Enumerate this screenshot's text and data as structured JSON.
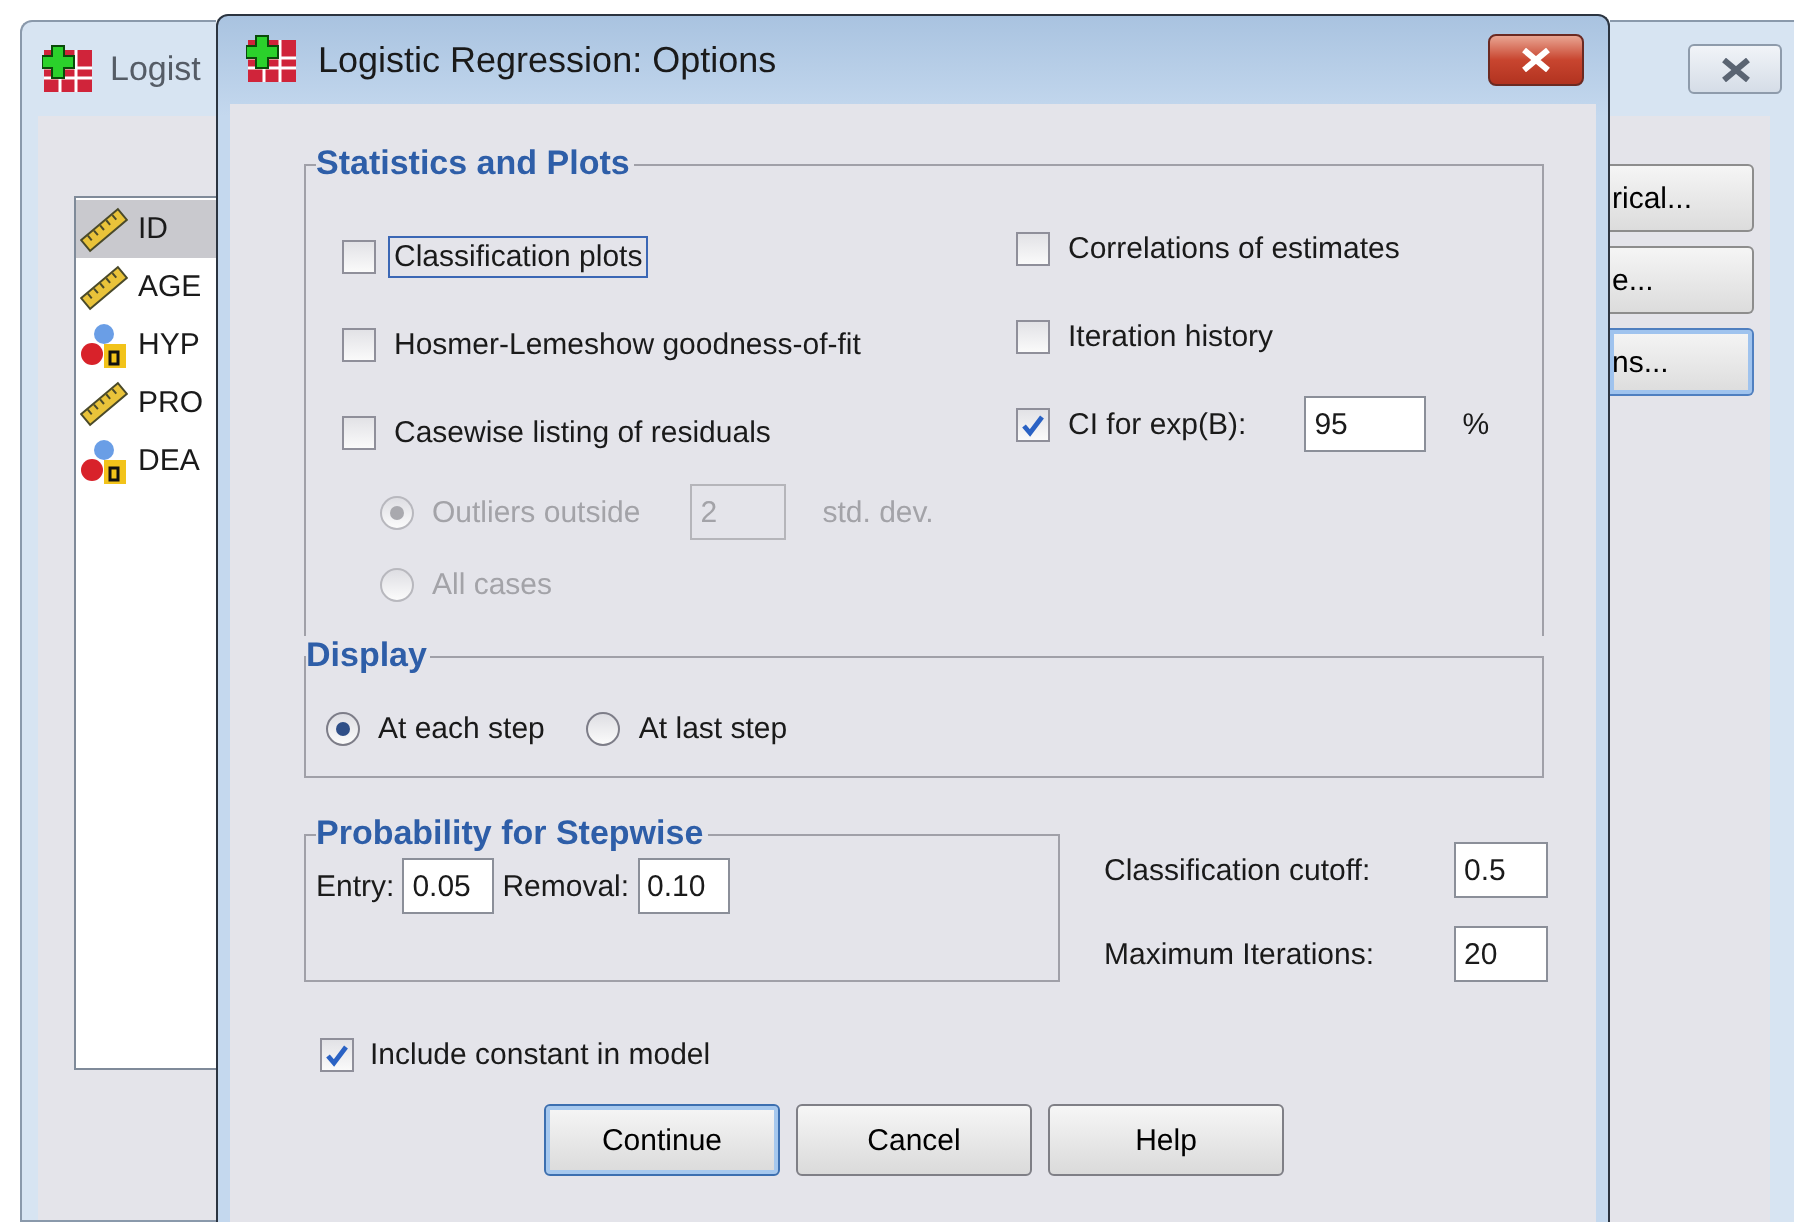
{
  "background_window": {
    "title": "Logist",
    "variables": [
      {
        "name": "ID",
        "kind": "scale",
        "selected": true
      },
      {
        "name": "AGE",
        "kind": "scale",
        "selected": false
      },
      {
        "name": "HYP",
        "kind": "nominal",
        "selected": false
      },
      {
        "name": "PRO",
        "kind": "scale",
        "selected": false
      },
      {
        "name": "DEA",
        "kind": "nominal",
        "selected": false
      }
    ],
    "buttons": [
      {
        "label": "rical...",
        "focused": false
      },
      {
        "label": "e...",
        "focused": false
      },
      {
        "label": "ns...",
        "focused": true
      }
    ]
  },
  "dialog": {
    "title": "Logistic Regression: Options",
    "statistics": {
      "legend": "Statistics and Plots",
      "left_options": [
        {
          "label": "Classification plots",
          "checked": false,
          "focused": true
        },
        {
          "label": "Hosmer-Lemeshow goodness-of-fit",
          "checked": false,
          "focused": false
        },
        {
          "label": "Casewise listing of residuals",
          "checked": false,
          "focused": false
        }
      ],
      "casewise_options": [
        {
          "label": "Outliers outside",
          "selected": true,
          "disabled": true,
          "value": "2",
          "unit": "std. dev."
        },
        {
          "label": "All cases",
          "selected": false,
          "disabled": true
        }
      ],
      "right_options": [
        {
          "label": "Correlations of estimates",
          "checked": false
        },
        {
          "label": "Iteration history",
          "checked": false
        },
        {
          "label": "CI for exp(B):",
          "checked": true,
          "value": "95",
          "unit": "%"
        }
      ]
    },
    "display": {
      "legend": "Display",
      "options": [
        {
          "label": "At each step",
          "selected": true
        },
        {
          "label": "At last step",
          "selected": false
        }
      ]
    },
    "stepwise": {
      "legend": "Probability for Stepwise",
      "fields": [
        {
          "label": "Entry:",
          "value": "0.05"
        },
        {
          "label": "Removal:",
          "value": "0.10"
        }
      ]
    },
    "cutoff_fields": [
      {
        "label": "Classification cutoff:",
        "value": "0.5"
      },
      {
        "label": "Maximum Iterations:",
        "value": "20"
      }
    ],
    "include_constant": {
      "label": "Include constant in model",
      "checked": true
    },
    "buttons": [
      {
        "label": "Continue",
        "default": true
      },
      {
        "label": "Cancel",
        "default": false
      },
      {
        "label": "Help",
        "default": false
      }
    ]
  }
}
